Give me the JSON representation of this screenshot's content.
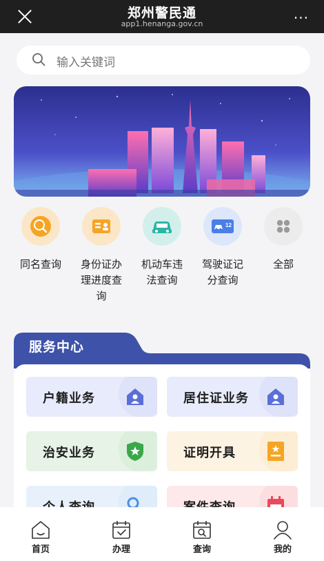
{
  "header": {
    "title": "郑州警民通",
    "url": "app1.henanga.gov.cn",
    "close_icon": "close-icon",
    "more_label": "···"
  },
  "search": {
    "placeholder": "输入关键词",
    "icon": "search-icon"
  },
  "banner": {
    "icon": "city-skyline-illustration"
  },
  "quick_actions": [
    {
      "label": "同名查询",
      "icon": "name-search-icon",
      "color": "#f5a524"
    },
    {
      "label": "身份证办理进度查询",
      "icon": "id-card-icon",
      "color": "#f5a524"
    },
    {
      "label": "机动车违法查询",
      "icon": "car-icon",
      "color": "#2bb5a5"
    },
    {
      "label": "驾驶证记分查询",
      "icon": "license-icon",
      "color": "#4a7ee8"
    },
    {
      "label": "全部",
      "icon": "grid-icon",
      "color": "#9a9a9a"
    }
  ],
  "service_center": {
    "title": "服务中心",
    "cards": [
      {
        "label": "户籍业务",
        "icon": "household-icon",
        "bg": "#e8ebfb",
        "accent": "#5b6fd8"
      },
      {
        "label": "居住证业务",
        "icon": "residence-icon",
        "bg": "#e8ebfb",
        "accent": "#5b6fd8"
      },
      {
        "label": "治安业务",
        "icon": "shield-star-icon",
        "bg": "#e6f3e6",
        "accent": "#3aa84a"
      },
      {
        "label": "证明开具",
        "icon": "certificate-icon",
        "bg": "#fdf3e3",
        "accent": "#f5a524"
      },
      {
        "label": "个人查询",
        "icon": "person-search-icon",
        "bg": "#e8f1fb",
        "accent": "#4a8ee8"
      },
      {
        "label": "案件查询",
        "icon": "calendar-icon",
        "bg": "#fde9ea",
        "accent": "#e84a5a"
      }
    ]
  },
  "bottom_nav": [
    {
      "label": "首页",
      "icon": "home-icon"
    },
    {
      "label": "办理",
      "icon": "handle-calendar-icon"
    },
    {
      "label": "查询",
      "icon": "query-calendar-icon"
    },
    {
      "label": "我的",
      "icon": "profile-icon"
    }
  ]
}
